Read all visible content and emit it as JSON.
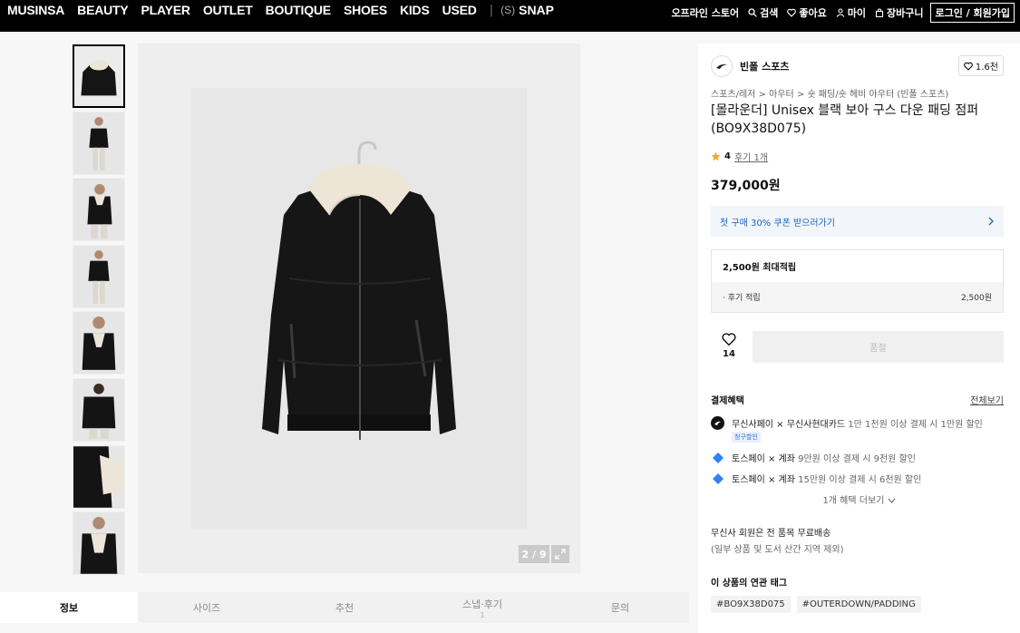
{
  "topnav": {
    "items": [
      "MUSINSA",
      "BEAUTY",
      "PLAYER",
      "OUTLET",
      "BOUTIQUE",
      "SHOES",
      "KIDS",
      "USED"
    ],
    "separator": "|",
    "snap_mark": "(S)",
    "snap_label": "SNAP",
    "right": {
      "offline_store": "오프라인 스토어",
      "search": "검색",
      "likes": "좋아요",
      "my": "마이",
      "cart": "장바구니",
      "login": "로그인 / 회원가입"
    }
  },
  "gallery": {
    "counter": "2 / 9",
    "thumb_count": 8
  },
  "tabs": [
    {
      "label": "정보",
      "sub": ""
    },
    {
      "label": "사이즈",
      "sub": ""
    },
    {
      "label": "추천",
      "sub": ""
    },
    {
      "label": "스냅·후기",
      "sub": "1"
    },
    {
      "label": "문의",
      "sub": ""
    }
  ],
  "product": {
    "brand": "빈폴 스포츠",
    "brand_likes": "1.6천",
    "breadcrumb": "스포츠/레저 > 아우터 > 숏 패딩/숏 헤비 아우터 (빈폴 스포츠)",
    "title": "[몰라운더] Unisex 블랙 보아 구스 다운 패딩 점퍼 (BO9X38D075)",
    "rating": "4",
    "review_link": "후기 1개",
    "price": "379,000원",
    "coupon": "첫 구매 30% 쿠폰 받으러가기",
    "points_header": "2,500원 최대적립",
    "points_row_label": "· 후기 적립",
    "points_row_value": "2,500원",
    "like_count": "14",
    "buy_label": "품절",
    "benefit_title": "결제혜택",
    "view_all": "전체보기",
    "benefits": [
      {
        "strong": "무신사페이 × 무신사현대카드",
        "rest": " 1만 1천원 이상 결제 시 1만원 할인",
        "badge": "청구할인"
      },
      {
        "strong": "토스페이 × 계좌",
        "rest": " 9만원 이상 결제 시 9천원 할인",
        "badge": ""
      },
      {
        "strong": "토스페이 × 계좌",
        "rest": " 15만원 이상 결제 시 6천원 할인",
        "badge": ""
      }
    ],
    "more_benefits": "1개 혜택 더보기",
    "shipping_line1": "무신사 회원은 전 품목 무료배송",
    "shipping_line2": "(일부 상품 및 도서 산간 지역 제외)",
    "tags_title": "이 상품의 연관 태그",
    "tags": [
      "#BO9X38D075",
      "#OUTERDOWN/PADDING"
    ]
  },
  "colors": {
    "nav_bg": "#000000",
    "coupon_text": "#1565c0",
    "star": "#f5a623",
    "toss_blue": "#3182f6"
  }
}
